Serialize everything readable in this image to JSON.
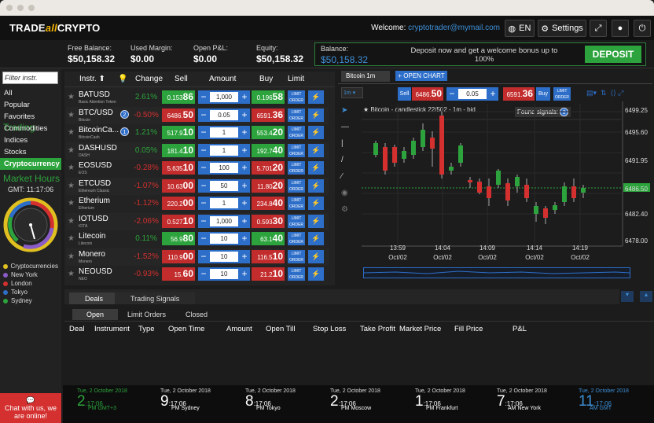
{
  "header": {
    "logo_a": "TRADE",
    "logo_b": "all",
    "logo_c": "CRYPTO",
    "welcome_label": "Welcome:",
    "email": "cryptotrader@mymail.com",
    "lang": "EN",
    "settings": "Settings"
  },
  "summary": {
    "free_balance_label": "Free Balance:",
    "free_balance": "$50,158.32",
    "used_margin_label": "Used Margin:",
    "used_margin": "$0.00",
    "open_pl_label": "Open P&L:",
    "open_pl": "$0.00",
    "equity_label": "Equity:",
    "equity": "$50,158.32",
    "balance_label": "Balance:",
    "balance": "$50,158.32",
    "deposit_msg": "Deposit now and get a welcome bonus up to 100%",
    "deposit_button": "DEPOSIT"
  },
  "sidebar": {
    "trading": "Trading",
    "filter_placeholder": "Filter instr.",
    "categories": [
      "All",
      "Popular",
      "Favorites",
      "Commodities",
      "Indices",
      "Stocks",
      "Cryptocurrency"
    ],
    "market_hours": "Market Hours",
    "gmt": "GMT: 11:17:06",
    "legend": [
      {
        "name": "Cryptocurrencies",
        "color": "#e0c020"
      },
      {
        "name": "New York",
        "color": "#8a5cc8"
      },
      {
        "name": "London",
        "color": "#d3302f"
      },
      {
        "name": "Tokyo",
        "color": "#2d6ec9"
      },
      {
        "name": "Sydney",
        "color": "#2ca33c"
      }
    ],
    "chat": "Chat with us, we are online!"
  },
  "instruments": {
    "headers": {
      "instr": "Instr.",
      "change": "Change",
      "sell": "Sell",
      "amount": "Amount",
      "buy": "Buy",
      "limit": "Limit"
    },
    "rows": [
      {
        "name": "BATUSD",
        "sub": "Basic Attention Token",
        "badge": "",
        "change": "2.61%",
        "dir": "up",
        "sell_a": "0.153",
        "sell_b": "86",
        "amount": "1,000",
        "buy_a": "0.196",
        "buy_b": "58",
        "sell_color": "green",
        "buy_color": "green"
      },
      {
        "name": "BTC/USD",
        "sub": "Bitcoin",
        "badge": "2",
        "change": "-0.50%",
        "dir": "dn",
        "sell_a": "6486.",
        "sell_b": "50",
        "amount": "0.05",
        "buy_a": "6591.",
        "buy_b": "36",
        "sell_color": "red",
        "buy_color": "red"
      },
      {
        "name": "BitcoinCa...",
        "sub": "BitcoinCash",
        "badge": "1",
        "change": "1.21%",
        "dir": "up",
        "sell_a": "517.9",
        "sell_b": "10",
        "amount": "1",
        "buy_a": "553.4",
        "buy_b": "20",
        "sell_color": "green",
        "buy_color": "green"
      },
      {
        "name": "DASHUSD",
        "sub": "DASH",
        "badge": "",
        "change": "0.05%",
        "dir": "up",
        "sell_a": "181.4",
        "sell_b": "10",
        "amount": "1",
        "buy_a": "192.7",
        "buy_b": "40",
        "sell_color": "green",
        "buy_color": "green"
      },
      {
        "name": "EOSUSD",
        "sub": "EOS",
        "badge": "",
        "change": "-0.28%",
        "dir": "dn",
        "sell_a": "5.635",
        "sell_b": "10",
        "amount": "100",
        "buy_a": "5.701",
        "buy_b": "20",
        "sell_color": "red",
        "buy_color": "red"
      },
      {
        "name": "ETCUSD",
        "sub": "Ethereum Classic",
        "badge": "",
        "change": "-1.07%",
        "dir": "dn",
        "sell_a": "10.63",
        "sell_b": "00",
        "amount": "50",
        "buy_a": "11.80",
        "buy_b": "20",
        "sell_color": "red",
        "buy_color": "red"
      },
      {
        "name": "Etherium",
        "sub": "Etherium",
        "badge": "",
        "change": "-1.12%",
        "dir": "dn",
        "sell_a": "220.2",
        "sell_b": "00",
        "amount": "1",
        "buy_a": "234.8",
        "buy_b": "40",
        "sell_color": "red",
        "buy_color": "red"
      },
      {
        "name": "IOTUSD",
        "sub": "IOTA",
        "badge": "",
        "change": "-2.06%",
        "dir": "dn",
        "sell_a": "0.527",
        "sell_b": "10",
        "amount": "1,000",
        "buy_a": "0.593",
        "buy_b": "30",
        "sell_color": "red",
        "buy_color": "red"
      },
      {
        "name": "Litecoin",
        "sub": "Litecoin",
        "badge": "",
        "change": "0.11%",
        "dir": "up",
        "sell_a": "56.9",
        "sell_b": "80",
        "amount": "10",
        "buy_a": "63.1",
        "buy_b": "40",
        "sell_color": "green",
        "buy_color": "green"
      },
      {
        "name": "Monero",
        "sub": "Monero",
        "badge": "",
        "change": "-1.52%",
        "dir": "dn",
        "sell_a": "110.9",
        "sell_b": "00",
        "amount": "10",
        "buy_a": "116.5",
        "buy_b": "10",
        "sell_color": "red",
        "buy_color": "red"
      },
      {
        "name": "NEOUSD",
        "sub": "NEO",
        "badge": "",
        "change": "-0.93%",
        "dir": "dn",
        "sell_a": "15.",
        "sell_b": "60",
        "amount": "10",
        "buy_a": "21.2",
        "buy_b": "10",
        "sell_color": "red",
        "buy_color": "red"
      }
    ]
  },
  "chart": {
    "tab": "Bitcoin 1m",
    "open_chart": "+ OPEN CHART",
    "sell_label": "Sell",
    "sell_a": "6486.",
    "sell_b": "50",
    "amount": "0.05",
    "buy_a": "6591.",
    "buy_b": "36",
    "buy_label": "Buy",
    "title": "Bitcoin - candlestick 22/502 - 1m - bid",
    "found_signals": "Found signals:",
    "signals_count": "2",
    "y_ticks": [
      "6499.25",
      "6495.60",
      "6491.95",
      "6486.50",
      "6482.40",
      "6478.00"
    ],
    "current": "6486.50",
    "x_ticks": [
      {
        "t": "13:59",
        "d": "Oct/02"
      },
      {
        "t": "14:04",
        "d": "Oct/02"
      },
      {
        "t": "14:09",
        "d": "Oct/02"
      },
      {
        "t": "14:14",
        "d": "Oct/02"
      },
      {
        "t": "14:19",
        "d": "Oct/02"
      }
    ]
  },
  "deals": {
    "tabs": [
      "Deals",
      "Trading Signals"
    ],
    "sub_tabs": [
      "Open",
      "Limit Orders",
      "Closed"
    ],
    "columns": [
      "Deal",
      "Instrument",
      "Type",
      "Open Time",
      "Amount",
      "Open Till",
      "Stop Loss",
      "Take Profit",
      "Market Price",
      "Fill Price",
      "P&L"
    ]
  },
  "clocks": [
    {
      "date": "Tue, 2 October 2018",
      "h": "2",
      "m": ":17:06",
      "ap": "PM",
      "city": "GMT+3",
      "style": "hl"
    },
    {
      "date": "Tue, 2 October 2018",
      "h": "9",
      "m": ":17:06",
      "ap": "PM",
      "city": "Sydney",
      "style": ""
    },
    {
      "date": "Tue, 2 October 2018",
      "h": "8",
      "m": ":17:06",
      "ap": "PM",
      "city": "Tokyo",
      "style": ""
    },
    {
      "date": "Tue, 2 October 2018",
      "h": "2",
      "m": ":17:06",
      "ap": "PM",
      "city": "Moscow",
      "style": ""
    },
    {
      "date": "Tue, 2 October 2018",
      "h": "1",
      "m": ":17:06",
      "ap": "PM",
      "city": "Frankfurt",
      "style": ""
    },
    {
      "date": "Tue, 2 October 2018",
      "h": "7",
      "m": ":17:06",
      "ap": "AM",
      "city": "New York",
      "style": ""
    },
    {
      "date": "Tue, 2 October 2018",
      "h": "11",
      "m": ":17:06",
      "ap": "AM",
      "city": "GMT",
      "style": "bl"
    }
  ]
}
